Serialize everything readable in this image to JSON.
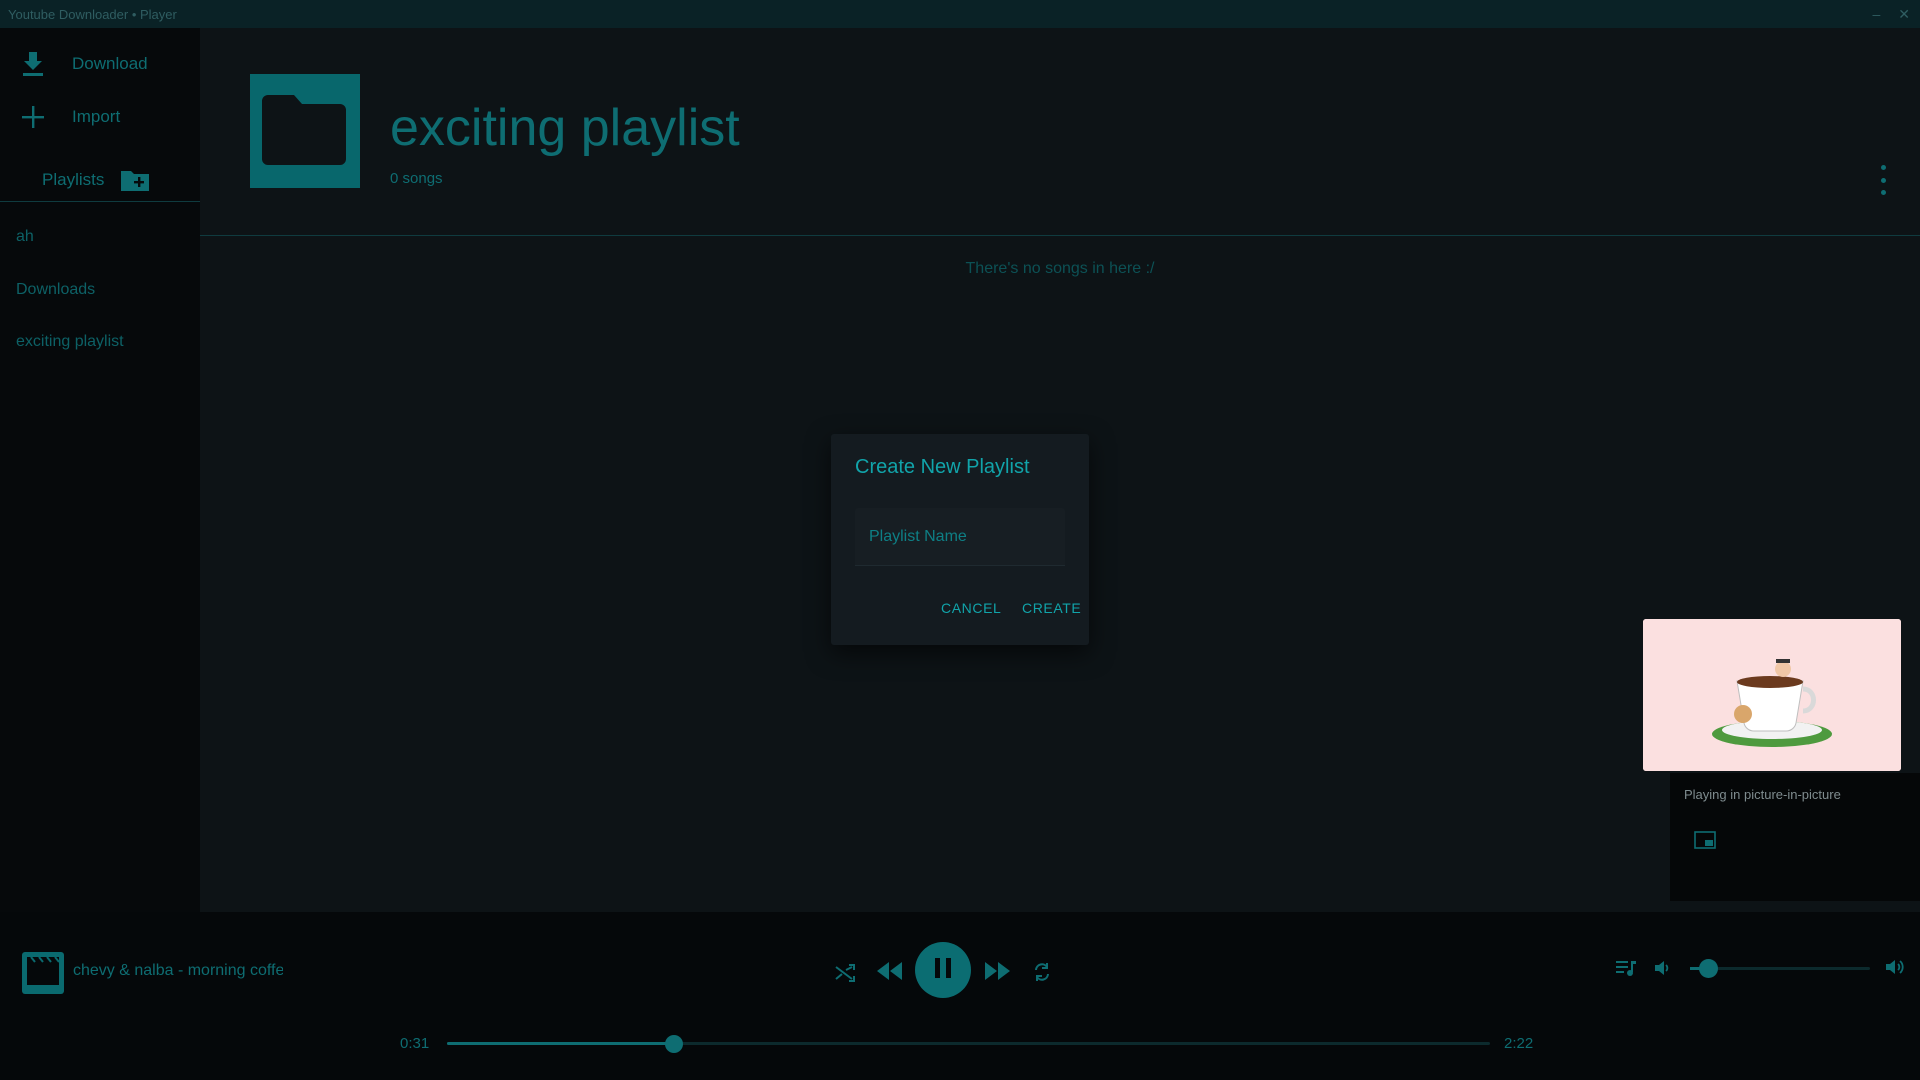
{
  "window": {
    "title": "Youtube Downloader • Player",
    "minimize": "–",
    "close": "✕"
  },
  "sidebar": {
    "download_label": "Download",
    "import_label": "Import",
    "playlists_label": "Playlists",
    "playlists": [
      "ah",
      "Downloads",
      "exciting playlist"
    ]
  },
  "playlist": {
    "title": "exciting playlist",
    "song_count": "0 songs",
    "empty_message": "There's no songs in here :/"
  },
  "dialog": {
    "title": "Create New Playlist",
    "input_placeholder": "Playlist Name",
    "input_value": "",
    "cancel_label": "CANCEL",
    "create_label": "CREATE"
  },
  "pip": {
    "status_text": "Playing in picture-in-picture"
  },
  "player": {
    "track_title": "chevy & nalba - morning coffee",
    "elapsed": "0:31",
    "duration": "2:22",
    "progress_fraction": 0.218,
    "volume_fraction": 0.1,
    "playing": true
  },
  "icons": {
    "download": "download-icon",
    "import": "plus-icon",
    "add_playlist": "folder-plus-icon",
    "cover": "folder-icon",
    "more": "more-vertical-icon",
    "shuffle": "shuffle-icon",
    "previous": "rewind-icon",
    "pause": "pause-icon",
    "next": "fast-forward-icon",
    "repeat": "repeat-icon",
    "queue": "queue-music-icon",
    "volume_low": "volume-low-icon",
    "volume_high": "volume-high-icon",
    "pip": "picture-in-picture-icon",
    "track_art": "movie-icon"
  },
  "colors": {
    "accent": "#0e6d72",
    "accent_bright": "#11a4aa",
    "background": "#0d1316",
    "sidebar": "#06090b",
    "dialog": "#141b20"
  }
}
